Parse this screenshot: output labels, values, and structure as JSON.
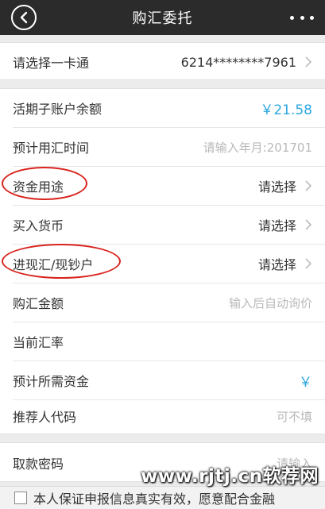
{
  "header": {
    "title": "购汇委托"
  },
  "card_select": {
    "label": "请选择一卡通",
    "value": "6214********7961"
  },
  "form": {
    "balance": {
      "label": "活期子账户余额",
      "value": "￥21.58"
    },
    "expected_date": {
      "label": "预计用汇时间",
      "placeholder": "请输入年月:201701"
    },
    "fund_use": {
      "label": "资金用途",
      "value": "请选择"
    },
    "buy_currency": {
      "label": "买入货币",
      "value": "请选择"
    },
    "cash_type": {
      "label": "进现汇/现钞户",
      "value": "请选择"
    },
    "amount": {
      "label": "购汇金额",
      "placeholder": "输入后自动询价"
    },
    "rate": {
      "label": "当前汇率"
    },
    "required_funds": {
      "label": "预计所需资金",
      "value": "￥"
    },
    "referrer": {
      "label": "推荐人代码",
      "placeholder": "可不填"
    }
  },
  "password": {
    "label": "取款密码",
    "placeholder": "请输入"
  },
  "footer": {
    "agreement": "本人保证申报信息真实有效，愿意配合金融"
  },
  "watermark": "www.rjtj.cn软荐网",
  "colors": {
    "header_bg": "#2b2b2b",
    "accent_blue": "#2aa7e0",
    "annotation_red": "#d8231d"
  }
}
